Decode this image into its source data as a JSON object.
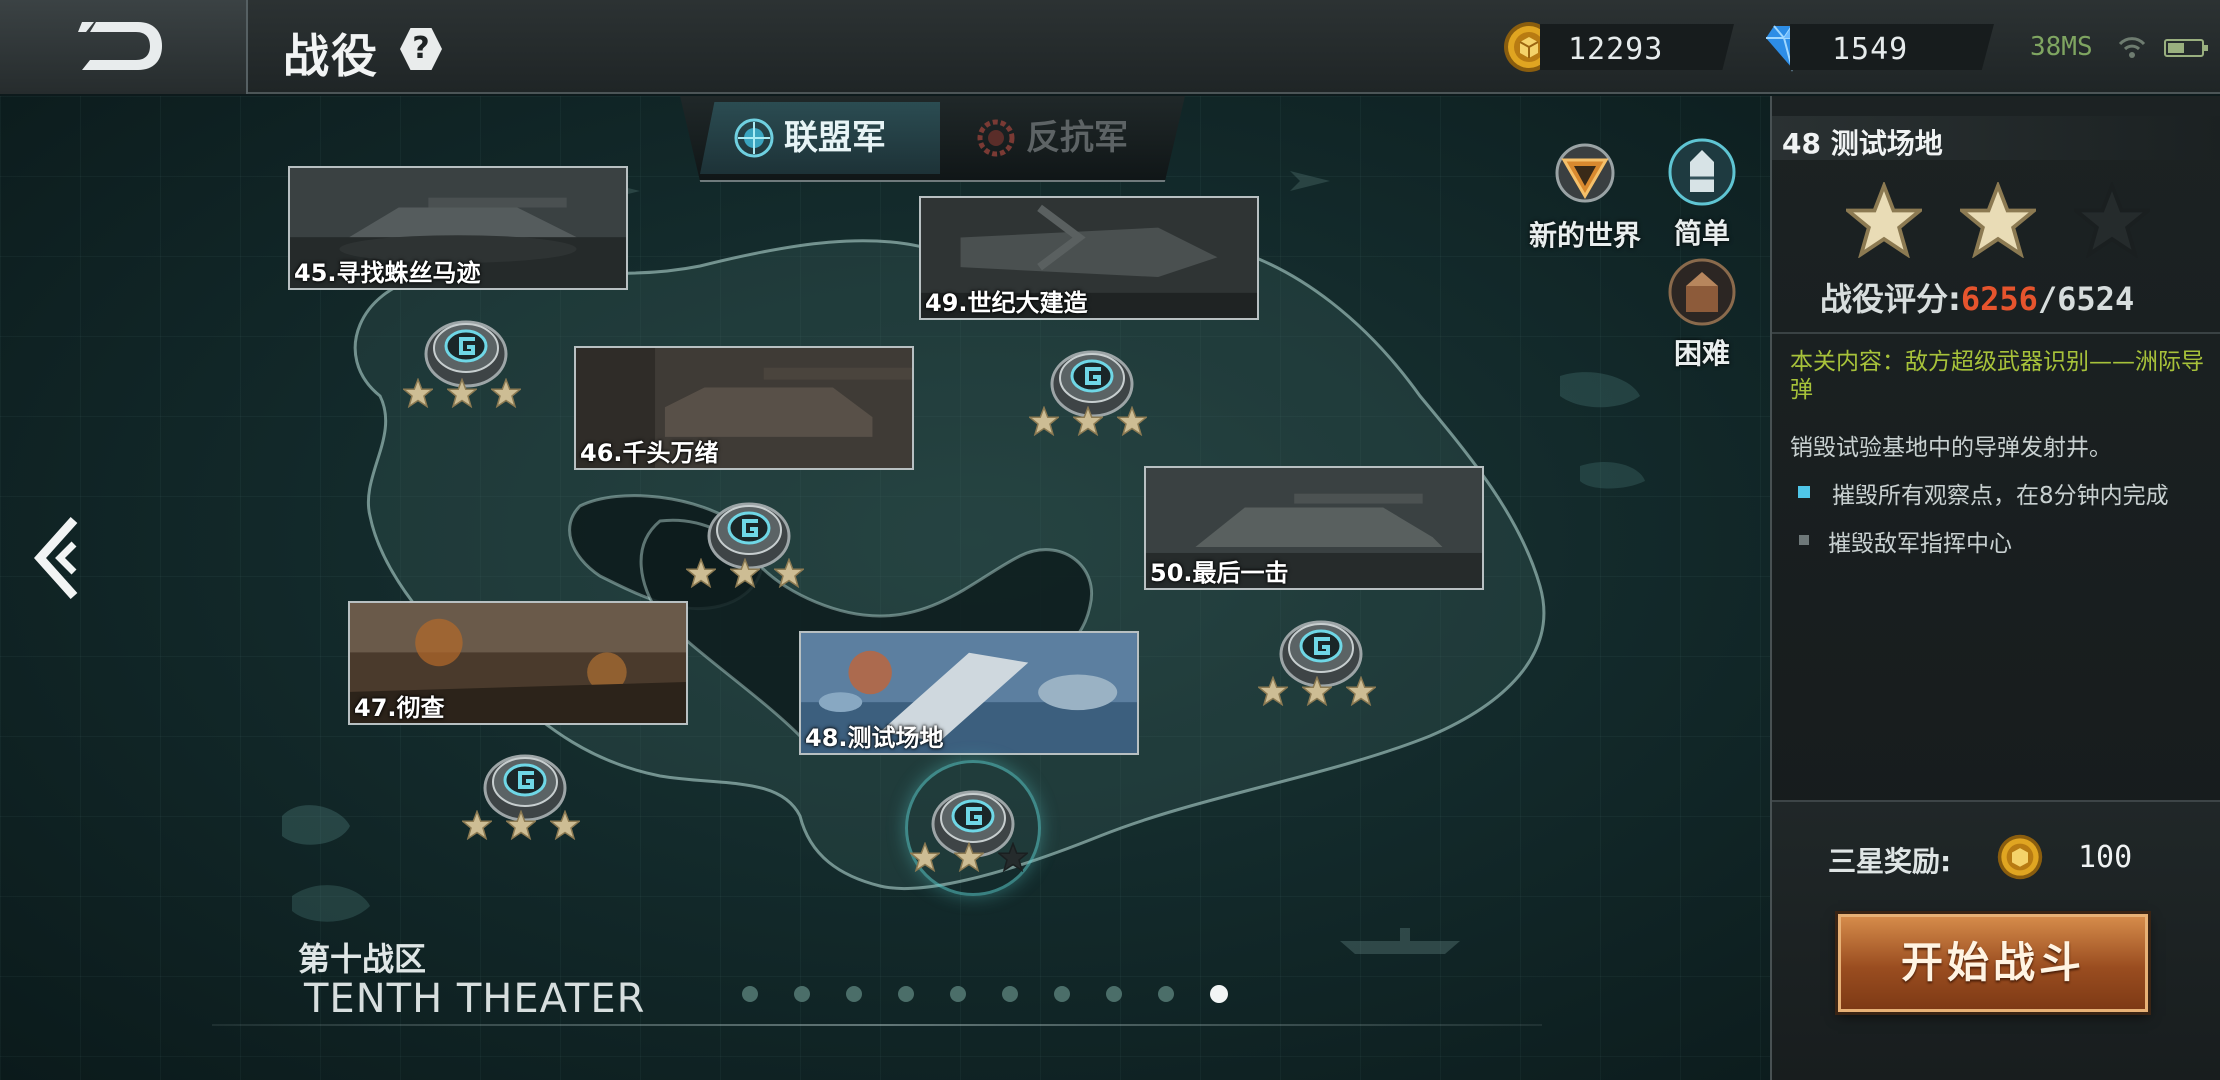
{
  "header": {
    "title": "战役",
    "help_icon": "question-icon",
    "gold": "12293",
    "gems": "1549",
    "ping": "38MS"
  },
  "factions": [
    {
      "label": "联盟军",
      "active": true
    },
    {
      "label": "反抗军",
      "active": false
    }
  ],
  "world_button": {
    "label": "新的世界",
    "icon": "triangle-emblem-icon"
  },
  "difficulty": [
    {
      "label": "简单",
      "icon": "bullet-icon"
    },
    {
      "label": "困难",
      "icon": "shell-icon"
    }
  ],
  "missions": [
    {
      "label": "45.寻找蛛丝马迹",
      "stars": 3
    },
    {
      "label": "46.千头万绪",
      "stars": 3
    },
    {
      "label": "47.彻查",
      "stars": 3
    },
    {
      "label": "48.测试场地",
      "stars": 2
    },
    {
      "label": "49.世纪大建造",
      "stars": 3
    },
    {
      "label": "50.最后一击",
      "stars": 3
    }
  ],
  "theater": {
    "cn": "第十战区",
    "en": "TENTH THEATER"
  },
  "pagination": {
    "total": 10,
    "active_index": 9
  },
  "panel": {
    "title": "48 测试场地",
    "stars_earned": 2,
    "stars_total": 3,
    "score_label": "战役评分:",
    "score_current": "6256",
    "score_max": "/6524",
    "content": "本关内容：敌方超级武器识别——洲际导弹",
    "description": "销毁试验基地中的导弹发射井。",
    "objectives": [
      {
        "text": "摧毁所有观察点，在8分钟内完成",
        "active": true
      },
      {
        "text": "摧毁敌军指挥中心",
        "active": false
      }
    ],
    "reward_label": "三星奖励:",
    "reward_value": "100",
    "start_button": "开始战斗"
  },
  "colors": {
    "accent_teal": "#4fc6c8",
    "score_red": "#e6542d",
    "content_green": "#a7c23a",
    "button_orange": "#b5622b"
  }
}
